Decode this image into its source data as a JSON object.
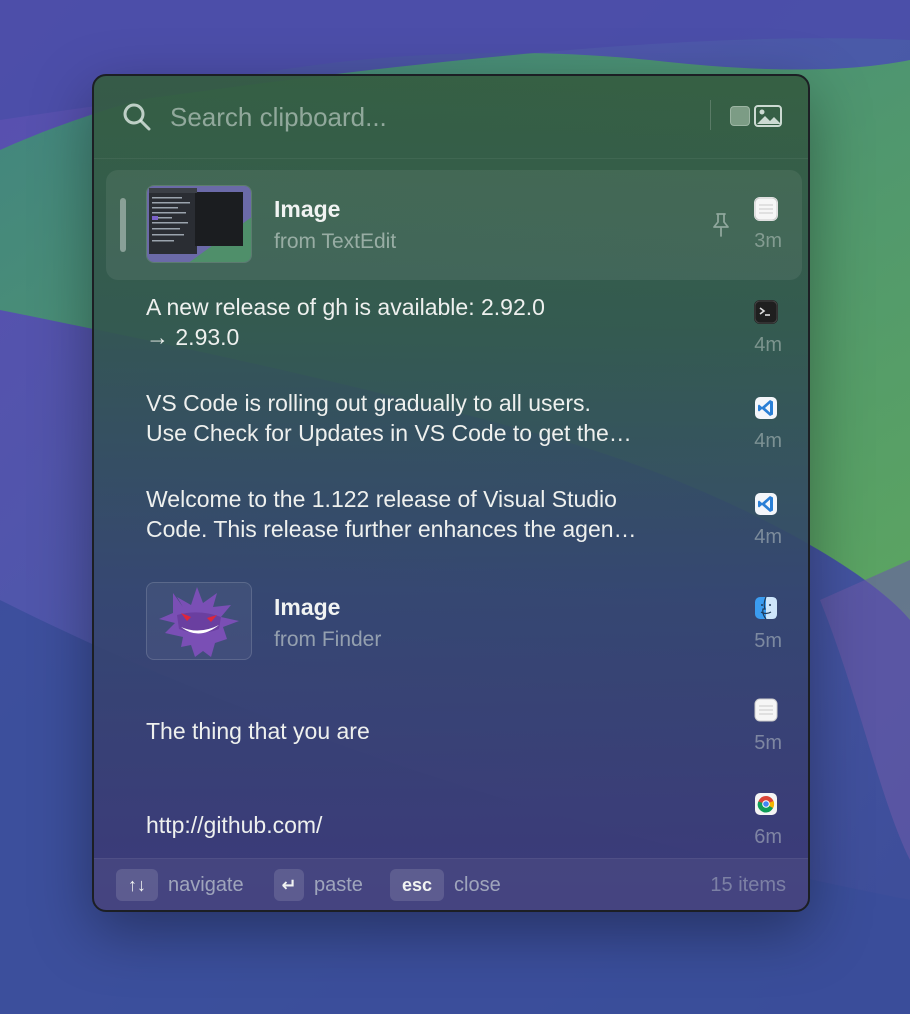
{
  "search": {
    "placeholder": "Search clipboard..."
  },
  "items": [
    {
      "kind": "image",
      "title": "Image",
      "source": "from TextEdit",
      "time": "3m",
      "app_icon": "textedit-icon",
      "pinned": true
    },
    {
      "kind": "text",
      "text": "A new release of gh is available: 2.92.0\n→ 2.93.0",
      "time": "4m",
      "app_icon": "terminal-icon"
    },
    {
      "kind": "text",
      "text": "VS Code is rolling out gradually to all users.\nUse Check for Updates in VS Code to get the…",
      "time": "4m",
      "app_icon": "vscode-icon"
    },
    {
      "kind": "text",
      "text": "Welcome to the 1.122 release of Visual Studio\nCode. This release further enhances the agen…",
      "time": "4m",
      "app_icon": "vscode-icon"
    },
    {
      "kind": "image",
      "title": "Image",
      "source": "from Finder",
      "time": "5m",
      "app_icon": "finder-icon"
    },
    {
      "kind": "text",
      "text": "The thing that you are",
      "time": "5m",
      "app_icon": "textedit-icon"
    },
    {
      "kind": "text",
      "text": "http://github.com/",
      "time": "6m",
      "app_icon": "chrome-icon"
    }
  ],
  "footer": {
    "navigate_key": "↑↓",
    "navigate": "navigate",
    "paste_key": "↵",
    "paste": "paste",
    "close_key": "esc",
    "close": "close",
    "count": "15 items"
  },
  "colors": {
    "panel_green": "#345c40",
    "panel_purple": "#3c3878",
    "wallpaper_green": "#5fae5a",
    "wallpaper_blue": "#4a55a8"
  }
}
